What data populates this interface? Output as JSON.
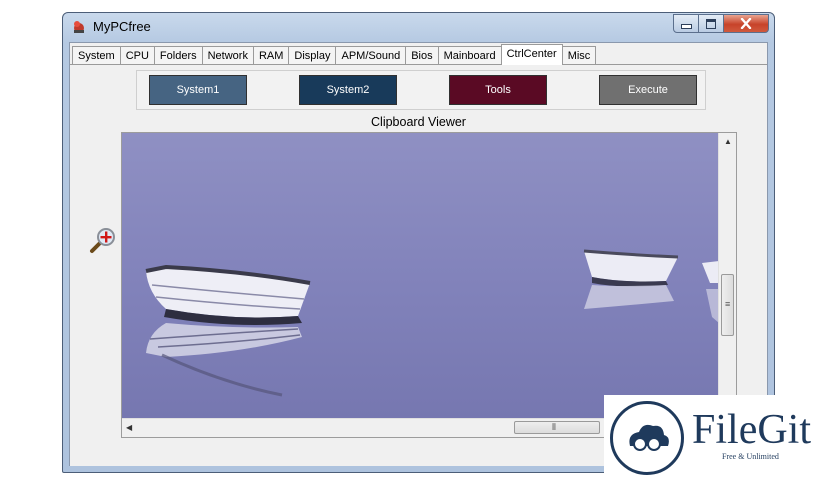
{
  "window": {
    "title": "MyPCfree",
    "app_icon": "app-icon",
    "caption_icons": [
      "minimize-icon",
      "maximize-icon",
      "close-icon"
    ]
  },
  "tabs": [
    {
      "label": "System"
    },
    {
      "label": "CPU"
    },
    {
      "label": "Folders"
    },
    {
      "label": "Network"
    },
    {
      "label": "RAM"
    },
    {
      "label": "Display"
    },
    {
      "label": "APM/Sound"
    },
    {
      "label": "Bios"
    },
    {
      "label": "Mainboard"
    },
    {
      "label": "CtrlCenter",
      "active": true
    },
    {
      "label": "Misc"
    }
  ],
  "ctrl_center": {
    "buttons": [
      {
        "label": "System1",
        "color": "#466482"
      },
      {
        "label": "System2",
        "color": "#183a5a"
      },
      {
        "label": "Tools",
        "color": "#5a0a24"
      },
      {
        "label": "Execute",
        "color": "#707070"
      }
    ],
    "clipboard_label": "Clipboard Viewer",
    "zoom_icon": "zoom-in-icon"
  },
  "watermark": {
    "name": "FileGit",
    "tagline": "Free & Unlimited",
    "icon": "cloud-logo-icon"
  }
}
